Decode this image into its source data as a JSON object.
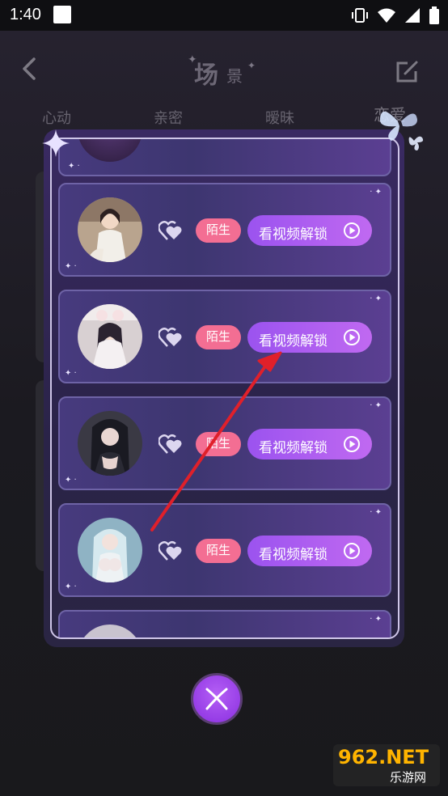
{
  "status_bar": {
    "time": "1:40"
  },
  "header": {
    "title_main": "场",
    "title_sub": "景"
  },
  "tabs": [
    {
      "label": "心动"
    },
    {
      "label": "亲密"
    },
    {
      "label": "暧昧"
    },
    {
      "label": "恋爱"
    }
  ],
  "rows": [
    {
      "badge": "陌生",
      "button_label": "看视频解锁"
    },
    {
      "badge": "陌生",
      "button_label": "看视频解锁"
    },
    {
      "badge": "陌生",
      "button_label": "看视频解锁"
    },
    {
      "badge": "陌生",
      "button_label": "看视频解锁"
    }
  ],
  "watermark": {
    "top": "962.NET",
    "bottom": "乐游网"
  },
  "colors": {
    "accent": "#a659ef",
    "badge": "#f36e93",
    "arrow": "#e0202a"
  }
}
